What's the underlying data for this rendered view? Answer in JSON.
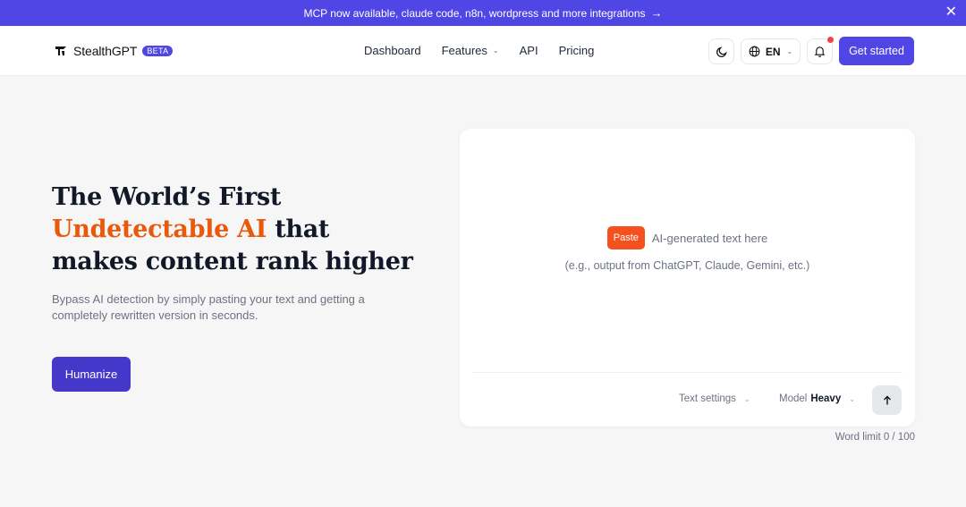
{
  "announcement": {
    "text": "MCP now available, claude code, n8n, wordpress and more integrations",
    "arrow_icon": "arrow-right-icon",
    "close_icon": "close-icon"
  },
  "nav": {
    "brand": "StealthGPT",
    "badge": "BETA",
    "items": [
      {
        "label": "Dashboard",
        "has_dropdown": false
      },
      {
        "label": "Features",
        "has_dropdown": true
      },
      {
        "label": "API",
        "has_dropdown": false
      },
      {
        "label": "Pricing",
        "has_dropdown": false
      }
    ],
    "language": "EN",
    "cta": "Get started"
  },
  "hero": {
    "title_line1": "The World’s First",
    "title_accent": "Undetectable AI",
    "title_line2_rest": " that",
    "title_line3": "makes content rank higher",
    "subtitle": "Bypass AI detection by simply pasting your text and getting a completely rewritten version in seconds.",
    "button": "Humanize"
  },
  "editor": {
    "paste_label": "Paste",
    "placeholder": "AI-generated text here",
    "example": "(e.g., output from ChatGPT, Claude, Gemini, etc.)",
    "text_settings": "Text settings",
    "model_label": "Model",
    "model_value": "Heavy",
    "word_limit": "Word limit 0 / 100"
  },
  "colors": {
    "brand": "#4f46e5",
    "accent": "#ea580c",
    "paste": "#f4511e",
    "notification": "#ef4444"
  }
}
